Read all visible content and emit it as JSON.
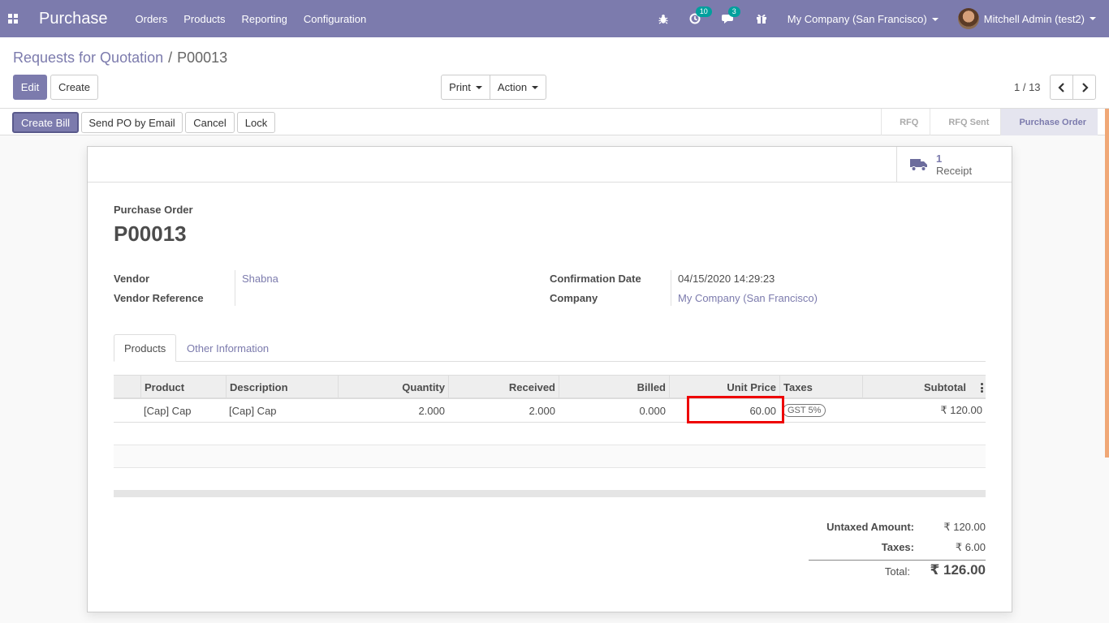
{
  "navbar": {
    "brand": "Purchase",
    "menu": [
      "Orders",
      "Products",
      "Reporting",
      "Configuration"
    ],
    "activity_count": "10",
    "message_count": "3",
    "company": "My Company (San Francisco)",
    "user": "Mitchell Admin (test2)"
  },
  "breadcrumb": {
    "parent": "Requests for Quotation",
    "separator": "/",
    "current": "P00013"
  },
  "actions": {
    "edit": "Edit",
    "create": "Create",
    "print": "Print",
    "action": "Action",
    "pager": "1 / 13"
  },
  "statusbar": {
    "create_bill": "Create Bill",
    "send_po": "Send PO by Email",
    "cancel": "Cancel",
    "lock": "Lock",
    "stages": [
      "RFQ",
      "RFQ Sent",
      "Purchase Order"
    ],
    "current_stage": "Purchase Order"
  },
  "smart_button": {
    "value": "1",
    "label": "Receipt"
  },
  "form": {
    "title_label": "Purchase Order",
    "title": "P00013",
    "vendor_label": "Vendor",
    "vendor": "Shabna",
    "vendor_ref_label": "Vendor Reference",
    "vendor_ref": "",
    "confirmation_label": "Confirmation Date",
    "confirmation": "04/15/2020 14:29:23",
    "company_label": "Company",
    "company": "My Company (San Francisco)"
  },
  "tabs": [
    "Products",
    "Other Information"
  ],
  "table": {
    "headers": [
      "Product",
      "Description",
      "Quantity",
      "Received",
      "Billed",
      "Unit Price",
      "Taxes",
      "Subtotal"
    ],
    "rows": [
      {
        "product": "[Cap] Cap",
        "description": "[Cap] Cap",
        "quantity": "2.000",
        "received": "2.000",
        "billed": "0.000",
        "unit_price": "60.00",
        "taxes": "GST 5%",
        "subtotal": "₹ 120.00"
      }
    ]
  },
  "totals": {
    "untaxed_label": "Untaxed Amount:",
    "untaxed": "₹ 120.00",
    "taxes_label": "Taxes:",
    "taxes": "₹ 6.00",
    "total_label": "Total:",
    "total": "₹ 126.00"
  },
  "colors": {
    "brand": "#7c7bad",
    "badge": "#00a09d",
    "highlight": "#e00000"
  }
}
